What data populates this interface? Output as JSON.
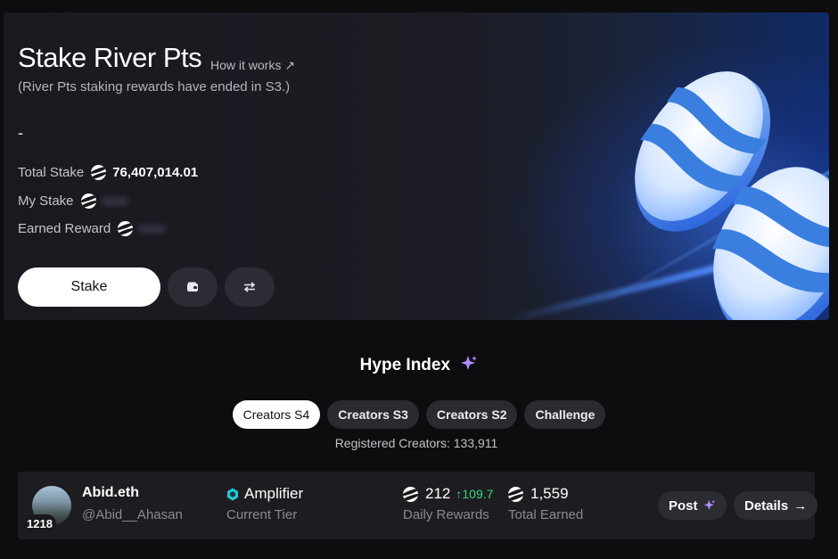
{
  "stake": {
    "title": "Stake River Pts",
    "how_it_works": "How it works ↗",
    "ended_note": "(River Pts staking rewards have ended in S3.)",
    "dash": "-",
    "total_stake_label": "Total Stake",
    "total_stake_value": "76,407,014.01",
    "my_stake_label": "My Stake",
    "earned_reward_label": "Earned Reward",
    "stake_button": "Stake",
    "wallet_icon": "wallet-icon",
    "swap_icon": "swap-icon"
  },
  "hype": {
    "title": "Hype Index",
    "tabs": [
      {
        "label": "Creators S4",
        "active": true
      },
      {
        "label": "Creators S3",
        "active": false
      },
      {
        "label": "Creators S2",
        "active": false
      },
      {
        "label": "Challenge",
        "active": false
      }
    ],
    "registered": "Registered Creators: 133,911"
  },
  "creator": {
    "rank": "1218",
    "name": "Abid.eth",
    "handle": "@Abid__Ahasan",
    "tier": "Amplifier",
    "tier_label": "Current Tier",
    "daily_rewards": "212",
    "daily_delta": "↑109.7",
    "daily_label": "Daily Rewards",
    "total_earned": "1,559",
    "earned_label": "Total Earned",
    "post_button": "Post",
    "details_button": "Details",
    "details_arrow": "→"
  },
  "colors": {
    "accent_green": "#37d67a",
    "tier_cyan": "#22c7d6",
    "sparkle_purple": "#b48cff",
    "coin_blue": "#3a7fe0"
  }
}
